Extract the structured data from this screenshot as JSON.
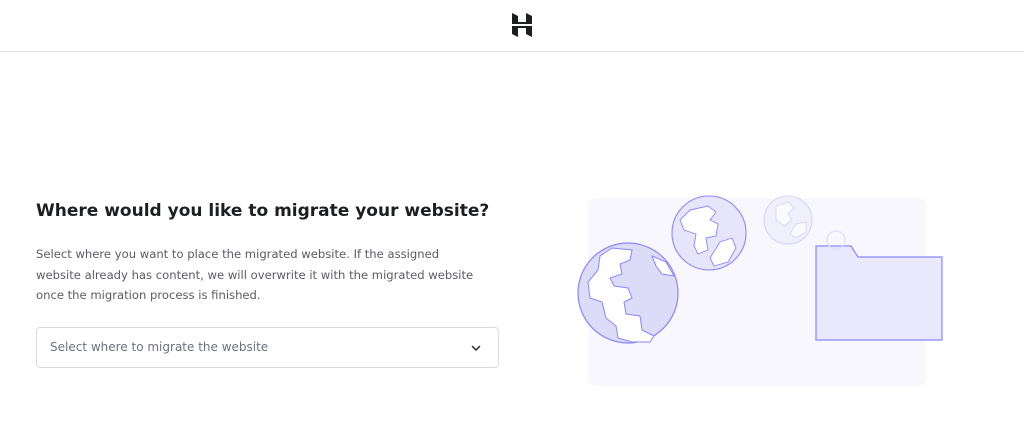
{
  "header": {
    "logo_icon": "hostinger-logo-icon"
  },
  "main": {
    "title": "Where would you like to migrate your website?",
    "description": "Select where you want to place the migrated website. If the assigned website already has content, we will overwrite it with the migrated website once the migration process is finished.",
    "select": {
      "placeholder": "Select where to migrate the website",
      "icon": "chevron-down-icon"
    }
  },
  "illustration": {
    "icons": [
      "globe-icon",
      "globe-icon",
      "globe-icon",
      "folder-icon"
    ]
  },
  "colors": {
    "illustration_fill": "#dcdcf8",
    "illustration_stroke": "#8c85ff",
    "illustration_bg": "#f7f7fd",
    "text": "#1d1e20",
    "muted_text": "#5b5b66"
  }
}
